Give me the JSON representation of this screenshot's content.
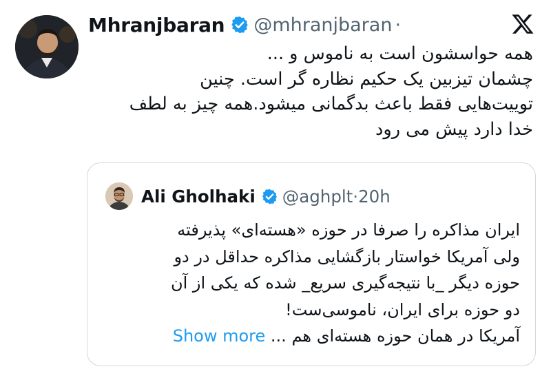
{
  "tweet": {
    "author_name": "Mhranjbaran",
    "handle": "@mhranjbaran",
    "separator": "·",
    "text_lines": [
      "همه حواسشون است به ناموس و ...",
      "چشمان تیزبین یک حکیم نظاره گر است. چنین",
      "توییت‌هایی فقط باعث بدگمانی میشود.همه چیز به لطف",
      "خدا دارد پیش می رود"
    ]
  },
  "quoted_tweet": {
    "author_name": "Ali Gholhaki",
    "handle": "@aghplt",
    "separator": "·",
    "time": "20h",
    "text_lines": [
      "ایران مذاکره را صرفا در حوزه «هسته‌ای» پذیرفته",
      "ولی آمریکا خواستار بازگشایی مذاکره حداقل در دو",
      "حوزه دیگر _با نتیجه‌گیری سریع_ شده که یکی از آن",
      "دو حوزه برای ایران، ناموسی‌ست!",
      "آمریکا در همان حوزه هسته‌ای هم ..."
    ],
    "show_more_label": "Show more"
  },
  "icons": {
    "verified": "verified-badge-icon",
    "platform_logo": "x-logo-icon"
  },
  "colors": {
    "link": "#1d9bf0",
    "secondary_text": "#536471",
    "verified": "#1d9bf0"
  }
}
